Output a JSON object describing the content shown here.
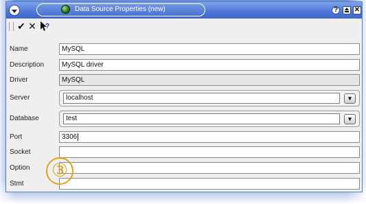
{
  "window": {
    "title": "Data Source Properties (new)",
    "icons": {
      "menu": "window-menu-icon",
      "app": "data-source-icon",
      "help": "help-icon",
      "shade": "shade-icon",
      "close": "close-icon"
    }
  },
  "toolbar": {
    "ok_glyph": "✔",
    "cancel_glyph": "✕",
    "help_glyph": "?"
  },
  "form": {
    "name": {
      "label": "Name",
      "value": "MySQL"
    },
    "description": {
      "label": "Description",
      "value": "MySQL driver"
    },
    "driver": {
      "label": "Driver",
      "value": "MySQL"
    },
    "server": {
      "label": "Server",
      "value": "localhost"
    },
    "database": {
      "label": "Database",
      "value": "test"
    },
    "port": {
      "label": "Port",
      "value": "3306"
    },
    "socket": {
      "label": "Socket",
      "value": ""
    },
    "option": {
      "label": "Option",
      "value": ""
    },
    "stmt": {
      "label": "Stmt",
      "value": ""
    }
  },
  "annotation": {
    "marker": "③",
    "color": "#e0a21c"
  },
  "colors": {
    "titlebar": "#4f79d8",
    "window_bg": "#efefef",
    "readonly_field": "#e6e6e6"
  }
}
